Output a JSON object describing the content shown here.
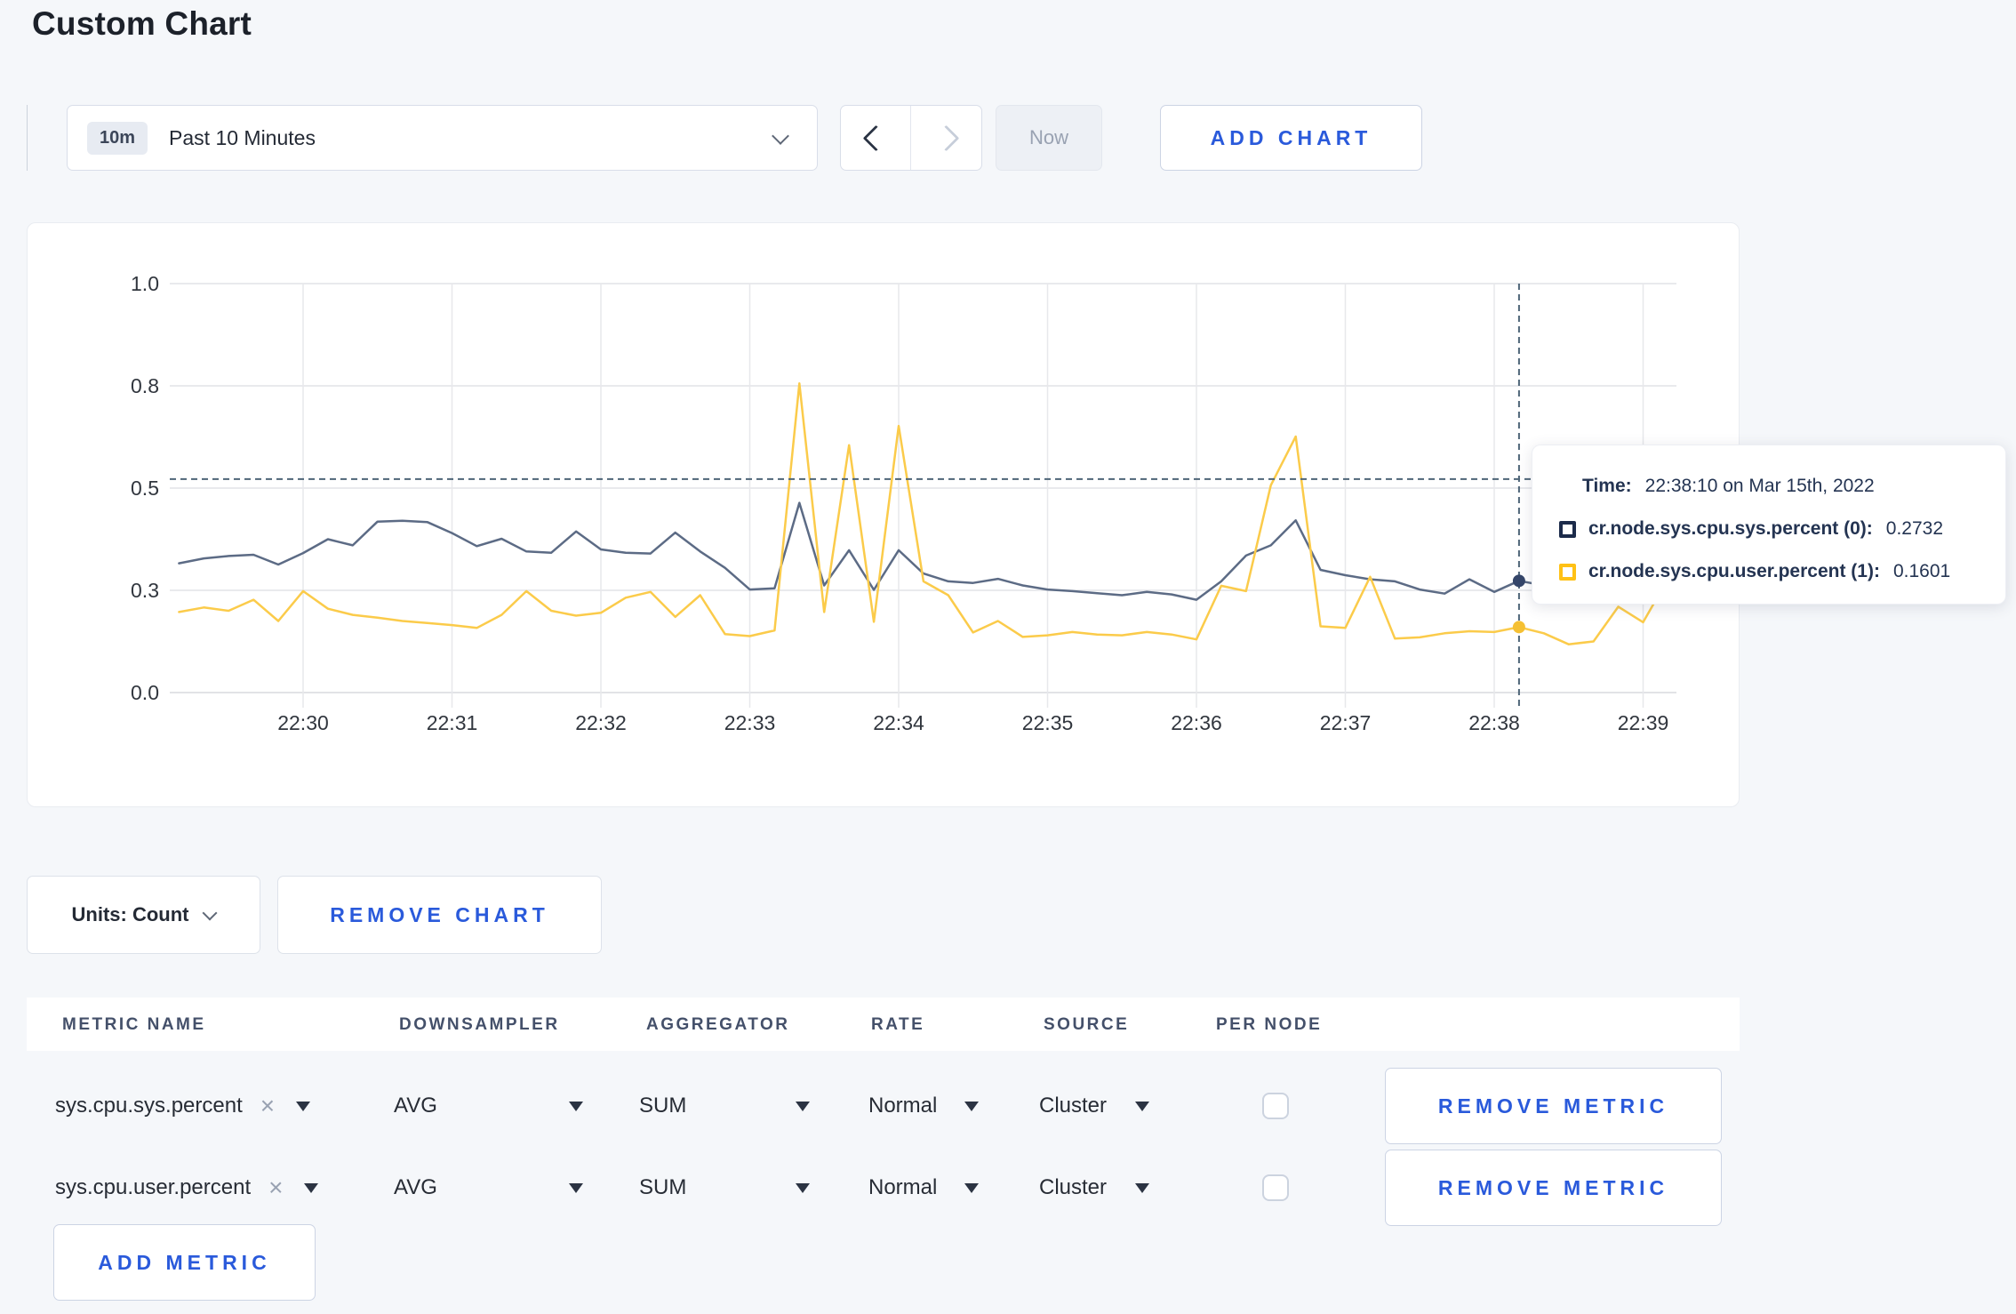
{
  "page": {
    "title": "Custom Chart"
  },
  "toolbar": {
    "time_picker": {
      "badge": "10m",
      "label": "Past 10 Minutes"
    },
    "now_button": "Now",
    "add_chart_button": "ADD CHART"
  },
  "chart_card": {
    "units_button": "Units: Count",
    "remove_chart_button": "REMOVE CHART",
    "tooltip": {
      "time_label": "Time:",
      "time_value": "22:38:10 on Mar 15th, 2022",
      "rows": [
        {
          "name": "cr.node.sys.cpu.sys.percent (0):",
          "value": "0.2732",
          "color": "#1c2b4a"
        },
        {
          "name": "cr.node.sys.cpu.user.percent (1):",
          "value": "0.1601",
          "color": "#ffc115"
        }
      ]
    }
  },
  "chart_data": {
    "type": "line",
    "title": "",
    "xlabel": "",
    "ylabel": "",
    "ylim": [
      0,
      1
    ],
    "x_start": "22:29:10",
    "x_interval_seconds": 10,
    "x_tick_labels": [
      "22:30",
      "22:31",
      "22:32",
      "22:33",
      "22:34",
      "22:35",
      "22:36",
      "22:37",
      "22:38",
      "22:39"
    ],
    "y_tick_labels": [
      "0.0",
      "0.3",
      "0.5",
      "0.8",
      "1.0"
    ],
    "y_gridline_values": [
      0,
      0.25,
      0.5,
      0.75,
      1.0
    ],
    "grid": true,
    "legend_position": "none",
    "series": [
      {
        "name": "cr.node.sys.cpu.sys.percent",
        "color": "#5c6b85",
        "values": [
          0.316,
          0.328,
          0.334,
          0.337,
          0.313,
          0.341,
          0.375,
          0.36,
          0.418,
          0.42,
          0.417,
          0.39,
          0.358,
          0.376,
          0.345,
          0.342,
          0.394,
          0.35,
          0.342,
          0.34,
          0.391,
          0.345,
          0.305,
          0.252,
          0.255,
          0.464,
          0.262,
          0.348,
          0.251,
          0.348,
          0.291,
          0.272,
          0.268,
          0.278,
          0.262,
          0.252,
          0.248,
          0.243,
          0.238,
          0.246,
          0.24,
          0.227,
          0.272,
          0.335,
          0.36,
          0.421,
          0.3,
          0.287,
          0.277,
          0.272,
          0.252,
          0.242,
          0.277,
          0.246,
          0.2732,
          0.262,
          0.252,
          0.25,
          0.255,
          0.262,
          0.272
        ]
      },
      {
        "name": "cr.node.sys.cpu.user.percent",
        "color": "#fbcb4a",
        "values": [
          0.197,
          0.208,
          0.2,
          0.227,
          0.175,
          0.248,
          0.205,
          0.19,
          0.183,
          0.175,
          0.17,
          0.165,
          0.158,
          0.19,
          0.248,
          0.2,
          0.188,
          0.195,
          0.232,
          0.246,
          0.185,
          0.238,
          0.143,
          0.138,
          0.152,
          0.756,
          0.197,
          0.605,
          0.173,
          0.652,
          0.272,
          0.238,
          0.147,
          0.175,
          0.136,
          0.14,
          0.148,
          0.142,
          0.14,
          0.148,
          0.142,
          0.13,
          0.261,
          0.248,
          0.507,
          0.626,
          0.162,
          0.158,
          0.283,
          0.132,
          0.135,
          0.145,
          0.15,
          0.148,
          0.1601,
          0.145,
          0.118,
          0.125,
          0.21,
          0.172,
          0.278
        ]
      }
    ],
    "crosshair": {
      "time": "22:38:10",
      "index": 54,
      "y_value": 0.522,
      "point_values": [
        0.2732,
        0.1601
      ],
      "point_colors": [
        "#35466a",
        "#f5c033"
      ]
    }
  },
  "metrics_table": {
    "headers": [
      "METRIC NAME",
      "DOWNSAMPLER",
      "AGGREGATOR",
      "RATE",
      "SOURCE",
      "PER NODE"
    ],
    "rows": [
      {
        "metric": "sys.cpu.sys.percent",
        "downsampler": "AVG",
        "aggregator": "SUM",
        "rate": "Normal",
        "source": "Cluster",
        "per_node_checked": false,
        "remove_button": "REMOVE METRIC"
      },
      {
        "metric": "sys.cpu.user.percent",
        "downsampler": "AVG",
        "aggregator": "SUM",
        "rate": "Normal",
        "source": "Cluster",
        "per_node_checked": false,
        "remove_button": "REMOVE METRIC"
      }
    ],
    "add_metric_button": "ADD METRIC"
  }
}
